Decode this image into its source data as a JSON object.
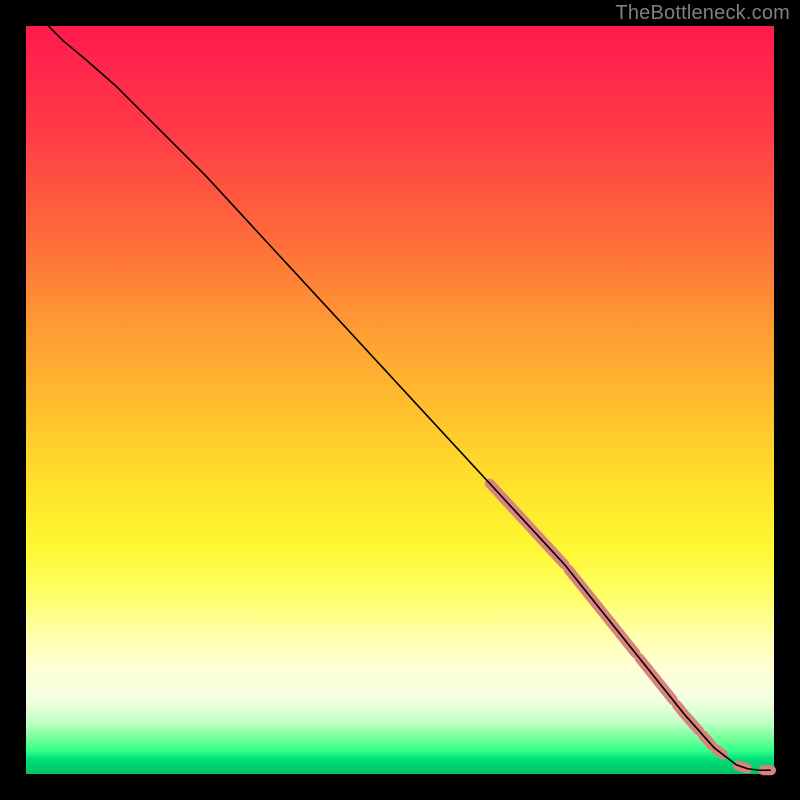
{
  "watermark": "TheBottleneck.com",
  "chart_data": {
    "type": "line",
    "title": "",
    "xlabel": "",
    "ylabel": "",
    "xlim": [
      0,
      100
    ],
    "ylim": [
      0,
      100
    ],
    "grid": false,
    "legend": false,
    "background": "rainbow-vertical",
    "curve": {
      "name": "bottleneck-curve",
      "x": [
        3,
        5,
        8,
        12,
        18,
        24,
        30,
        36,
        42,
        48,
        54,
        60,
        66,
        72,
        76,
        80,
        84,
        88,
        92,
        95,
        96.5,
        98,
        99.5
      ],
      "y": [
        100,
        98,
        95.5,
        92,
        86,
        80,
        73.5,
        67,
        60.5,
        54,
        47.5,
        41,
        34.5,
        28,
        23,
        18,
        13,
        8,
        3.5,
        1.2,
        0.7,
        0.5,
        0.5
      ]
    },
    "highlighted_segments": {
      "color": "#d9837f",
      "width": 10,
      "ranges_x": [
        [
          62,
          72
        ],
        [
          72.5,
          79
        ],
        [
          79.3,
          81.5
        ],
        [
          82,
          86.5
        ],
        [
          87,
          90
        ],
        [
          90.5,
          91.8
        ],
        [
          92.3,
          93.2
        ],
        [
          95.2,
          96.4
        ],
        [
          98.6,
          99.6
        ]
      ]
    }
  }
}
